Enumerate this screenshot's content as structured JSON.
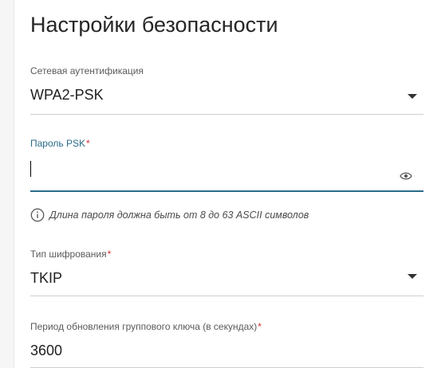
{
  "page": {
    "title": "Настройки безопасности"
  },
  "network_auth": {
    "label": "Сетевая аутентификация",
    "value": "WPA2-PSK"
  },
  "psk_password": {
    "label": "Пароль PSK",
    "value": ""
  },
  "hint": {
    "text": "Длина пароля должна быть от 8 до 63 ASCII символов"
  },
  "encryption": {
    "label": "Тип шифрования",
    "value": "TKIP"
  },
  "group_key": {
    "label": "Период обновления группового ключа (в секундах)",
    "value": "3600"
  },
  "colors": {
    "accent": "#2a6b8a",
    "required": "#d32f2f"
  }
}
